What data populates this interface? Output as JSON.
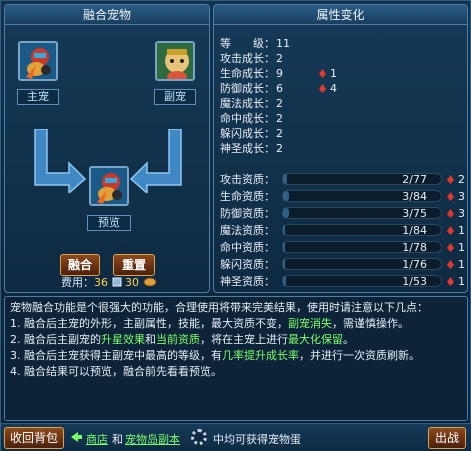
{
  "left_panel": {
    "title": "融合宠物",
    "main_pet_label": "主宠",
    "sub_pet_label": "副宠",
    "preview_label": "预览",
    "fuse_button": "融合",
    "reset_button": "重置",
    "cost_label": "费用：",
    "cost_item_1": "36",
    "cost_item_2": "30"
  },
  "right_panel": {
    "title": "属性变化",
    "growth": [
      {
        "label": "等　　级：",
        "value": "11",
        "bonus": ""
      },
      {
        "label": "攻击成长：",
        "value": "2",
        "bonus": ""
      },
      {
        "label": "生命成长：",
        "value": "9",
        "bonus": "1"
      },
      {
        "label": "防御成长：",
        "value": "6",
        "bonus": "4"
      },
      {
        "label": "魔法成长：",
        "value": "2",
        "bonus": ""
      },
      {
        "label": "命中成长：",
        "value": "2",
        "bonus": ""
      },
      {
        "label": "躲闪成长：",
        "value": "2",
        "bonus": ""
      },
      {
        "label": "神圣成长：",
        "value": "2",
        "bonus": ""
      }
    ],
    "aptitude": [
      {
        "label": "攻击资质：",
        "value": "2/77",
        "bonus": "2",
        "fill": 0.026
      },
      {
        "label": "生命资质：",
        "value": "3/84",
        "bonus": "3",
        "fill": 0.036
      },
      {
        "label": "防御资质：",
        "value": "3/75",
        "bonus": "3",
        "fill": 0.04
      },
      {
        "label": "魔法资质：",
        "value": "1/84",
        "bonus": "1",
        "fill": 0.012
      },
      {
        "label": "命中资质：",
        "value": "1/78",
        "bonus": "1",
        "fill": 0.013
      },
      {
        "label": "躲闪资质：",
        "value": "1/76",
        "bonus": "1",
        "fill": 0.013
      },
      {
        "label": "神圣资质：",
        "value": "1/53",
        "bonus": "1",
        "fill": 0.019
      }
    ],
    "accent_bonus_color": "#e0392b"
  },
  "description": {
    "intro": "宠物融合功能是个很强大的功能，合理使用将带来完美结果，使用时请注意以下几点：",
    "l1_a": "1. 融合后主宠的外形，主副属性，技能，最大资质不变，",
    "l1_b": "副宠消失",
    "l1_c": "，需谨慎操作。",
    "l2_a": "2. 融合后主副宠的",
    "l2_b": "升星效果",
    "l2_c": "和",
    "l2_d": "当前资质",
    "l2_e": "，将在主宠上进行",
    "l2_f": "最大化保留",
    "l2_g": "。",
    "l3_a": "3. 融合后主宠获得主副宠中最高的等级，有",
    "l3_b": "几率提升成长率",
    "l3_c": "，并进行一次资质刷新。",
    "l4": "4. 融合结果可以预览，融合前先看看预览。",
    "highlight_color": "#7dff6b"
  },
  "bottom_bar": {
    "back_button": "收回背包",
    "shop_link": "商店",
    "and_text": "和",
    "island_link": "宠物岛副本",
    "tail_text": "中均可获得宠物蛋",
    "exit_button": "出战"
  }
}
